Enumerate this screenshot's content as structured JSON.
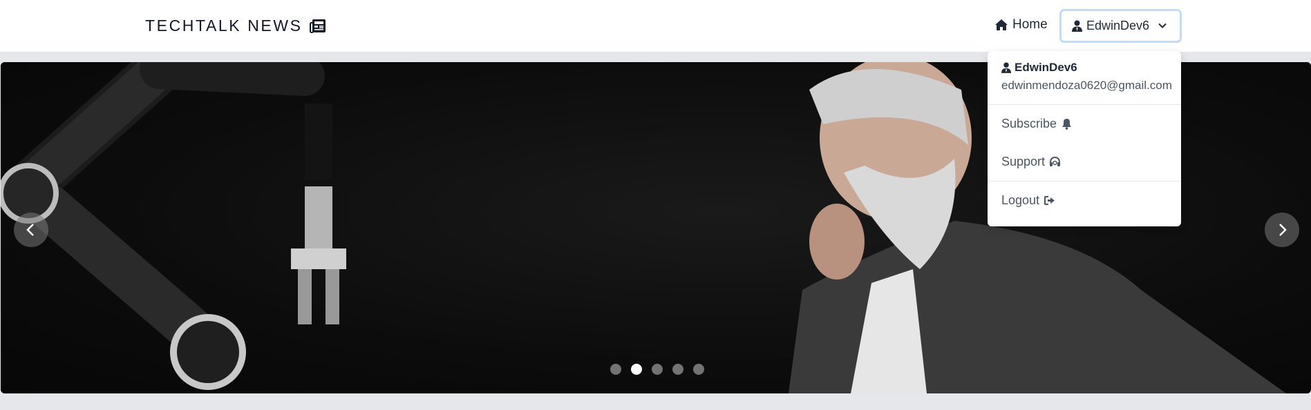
{
  "navbar": {
    "brand": "TECHTALK NEWS",
    "brand_icon": "newspaper-icon",
    "home_label": "Home",
    "home_icon": "home-icon",
    "user_button_label": "EdwinDev6"
  },
  "dropdown": {
    "username": "EdwinDev6",
    "email": "edwinmendoza0620@gmail.com",
    "items": [
      {
        "label": "Subscribe",
        "icon": "bell-icon"
      },
      {
        "label": "Support",
        "icon": "headset-icon"
      },
      {
        "label": "Logout",
        "icon": "logout-icon"
      }
    ]
  },
  "carousel": {
    "slide_count": 5,
    "active_index": 1
  },
  "colors": {
    "page_bg": "#e5e7eb",
    "focus_ring": "#bfdbfe",
    "text_dark": "#111827"
  }
}
